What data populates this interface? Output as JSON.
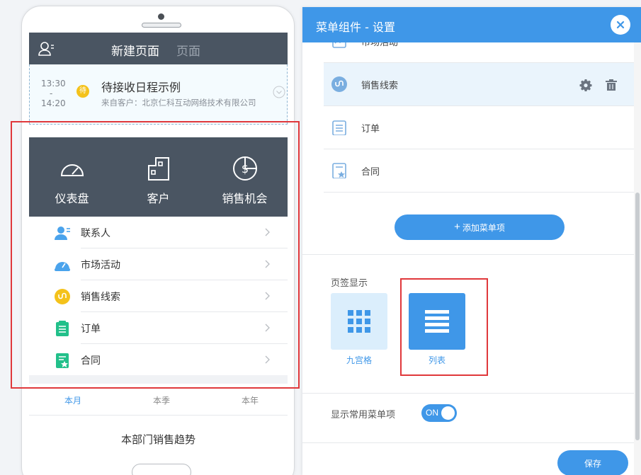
{
  "phone": {
    "title": "新建页面",
    "title_secondary": "页面",
    "schedule": {
      "start": "13:30",
      "dash": "-",
      "end": "14:20",
      "badge": "待",
      "event": "待接收日程示例",
      "from": "来自客户：北京仁科互动网络技术有限公司"
    },
    "menu_items": [
      {
        "label": "仪表盘",
        "icon": "dashboard-icon"
      },
      {
        "label": "客户",
        "icon": "building-icon"
      },
      {
        "label": "销售机会",
        "icon": "dollar-bag-icon"
      }
    ],
    "list_items": [
      {
        "label": "联系人",
        "icon": "contact-icon"
      },
      {
        "label": "市场活动",
        "icon": "campaign-icon"
      },
      {
        "label": "销售线索",
        "icon": "lead-icon"
      },
      {
        "label": "订单",
        "icon": "order-icon"
      },
      {
        "label": "合同",
        "icon": "contract-icon"
      }
    ],
    "tabs": [
      "本月",
      "本季",
      "本年"
    ],
    "trend_title": "本部门销售趋势"
  },
  "panel": {
    "title": "菜单组件 - 设置",
    "rows": [
      {
        "label": "市场活动",
        "icon": "campaign-icon"
      },
      {
        "label": "销售线索",
        "icon": "lead-icon",
        "selected": true
      },
      {
        "label": "订单",
        "icon": "order-icon"
      },
      {
        "label": "合同",
        "icon": "contract-icon"
      }
    ],
    "add_button": "添加菜单项",
    "tab_display_label": "页签显示",
    "options": [
      {
        "label": "九宫格",
        "icon": "grid-icon"
      },
      {
        "label": "列表",
        "icon": "list-icon",
        "selected": true
      }
    ],
    "show_common_label": "显示常用菜单项",
    "toggle_text": "ON",
    "save_button": "保存"
  },
  "colors": {
    "accent": "#3f97e8",
    "dark_bar": "#4a5562",
    "highlight": "#e0383b"
  }
}
